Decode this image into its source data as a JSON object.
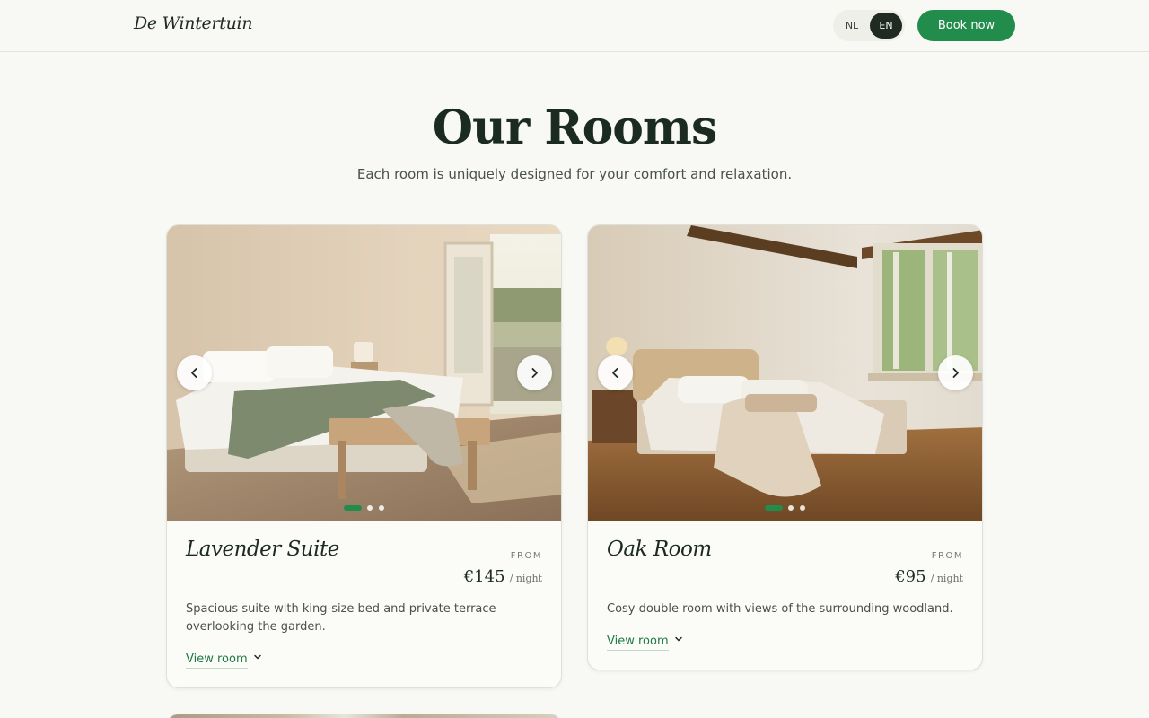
{
  "header": {
    "logo": "De Wintertuin",
    "lang": {
      "nl": "NL",
      "en": "EN",
      "active": "EN"
    },
    "book_label": "Book now"
  },
  "hero": {
    "title": "Our Rooms",
    "subtitle": "Each room is uniquely designed for your comfort and relaxation."
  },
  "rooms": [
    {
      "name": "Lavender Suite",
      "from_label": "FROM",
      "price": "€145",
      "per_night": "/ night",
      "description": "Spacious suite with king-size bed and private terrace overlooking the garden.",
      "view_label": "View room",
      "slides": 3,
      "active_slide": 1
    },
    {
      "name": "Oak Room",
      "from_label": "FROM",
      "price": "€95",
      "per_night": "/ night",
      "description": "Cosy double room with views of the surrounding woodland.",
      "view_label": "View room",
      "slides": 3,
      "active_slide": 1
    }
  ],
  "colors": {
    "accent": "#218c4c",
    "background": "#f8f8f4",
    "heading": "#1c2b21"
  },
  "icons": {
    "prev": "chevron-left-icon",
    "next": "chevron-right-icon",
    "expand": "chevron-down-icon"
  }
}
